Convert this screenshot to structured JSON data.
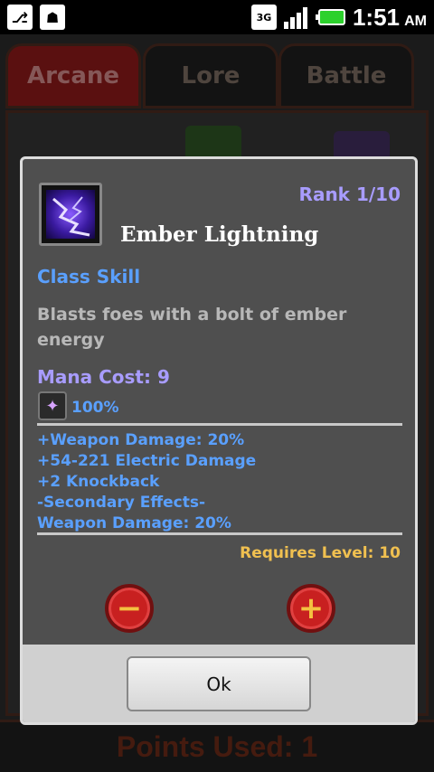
{
  "status_bar": {
    "time": "1:51",
    "ampm": "AM",
    "network": "3G",
    "icons": [
      "usb-icon",
      "android-debug-icon",
      "signal-icon",
      "battery-icon"
    ]
  },
  "tabs": [
    {
      "label": "Arcane",
      "active": true
    },
    {
      "label": "Lore",
      "active": false
    },
    {
      "label": "Battle",
      "active": false
    }
  ],
  "points_used": "Points Used: 1",
  "dialog": {
    "rank": "Rank 1/10",
    "skill_name": "Ember Lightning",
    "skill_type": "Class Skill",
    "description": "Blasts foes with a bolt of ember energy",
    "mana_cost": "Mana Cost: 9",
    "weapon_pct": "100%",
    "effects": [
      "+Weapon Damage: 20%",
      "+54-221 Electric Damage",
      "+2 Knockback",
      "-Secondary Effects-",
      "Weapon Damage: 20%"
    ],
    "requires_level": "Requires Level: 10",
    "ok_label": "Ok"
  },
  "colors": {
    "rank": "#a89cff",
    "skill_type": "#5aa0ff",
    "requires": "#f0c050",
    "dialog_bg": "#4f4f4f"
  }
}
